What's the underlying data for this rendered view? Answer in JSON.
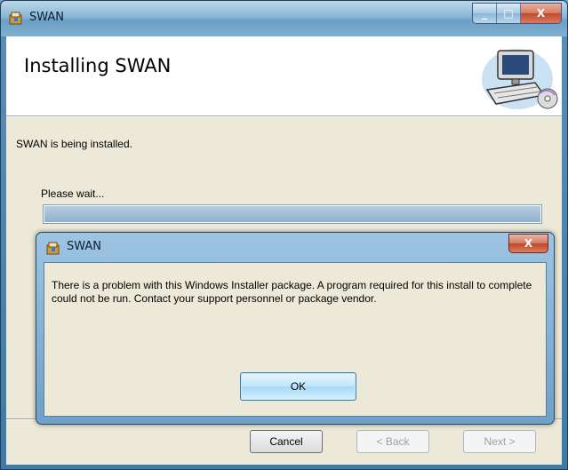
{
  "main_window": {
    "title": "SWAN",
    "caption_buttons": {
      "minimize": "_",
      "maximize": "□",
      "close": "X"
    },
    "banner_title": "Installing SWAN",
    "banner_icon": "computer-installer-icon",
    "status_text": "SWAN is being installed.",
    "wait_text": "Please wait...",
    "progress_fraction": 1.0,
    "buttons": {
      "cancel": "Cancel",
      "back": "< Back",
      "next": "Next >"
    }
  },
  "dialog": {
    "title": "SWAN",
    "close_glyph": "X",
    "message": "There is a problem with this Windows Installer package. A program required for this install to complete could not be run. Contact your support personnel or package vendor.",
    "ok_label": "OK"
  },
  "colors": {
    "title_bar": "#88b6d5",
    "close_button": "#c2482d",
    "window_face": "#ece9d8",
    "ok_button": "#bee6fd"
  }
}
